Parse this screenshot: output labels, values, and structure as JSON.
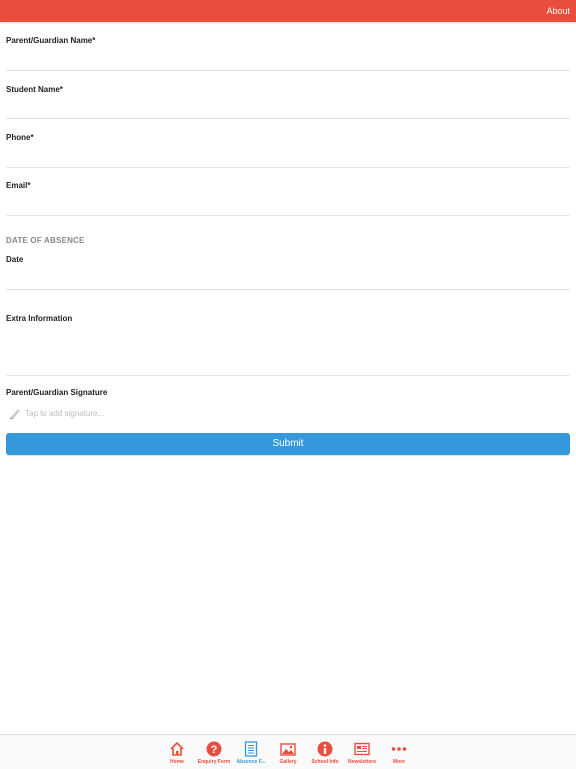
{
  "header": {
    "about_label": "About"
  },
  "form": {
    "fields": [
      {
        "label": "Parent/Guardian Name*"
      },
      {
        "label": "Student Name*"
      },
      {
        "label": "Phone*"
      },
      {
        "label": "Email*"
      }
    ],
    "date_section_heading": "DATE OF ABSENCE",
    "date_label": "Date",
    "extra_info_label": "Extra Information",
    "signature_label": "Parent/Guardian Signature",
    "signature_placeholder": "Tap to add signature...",
    "submit_label": "Submit"
  },
  "tabbar": {
    "tabs": [
      {
        "label": "Home",
        "icon": "home-icon",
        "active": false
      },
      {
        "label": "Enquiry Form",
        "icon": "question-icon",
        "active": false
      },
      {
        "label": "Absence F...",
        "icon": "form-icon",
        "active": true
      },
      {
        "label": "Gallery",
        "icon": "gallery-icon",
        "active": false
      },
      {
        "label": "School Info",
        "icon": "info-icon",
        "active": false
      },
      {
        "label": "Newsletters",
        "icon": "newsletter-icon",
        "active": false
      },
      {
        "label": "More",
        "icon": "more-icon",
        "active": false
      }
    ]
  },
  "colors": {
    "accent": "#e94e3c",
    "submit": "#3498db",
    "active_tab": "#3498db"
  }
}
